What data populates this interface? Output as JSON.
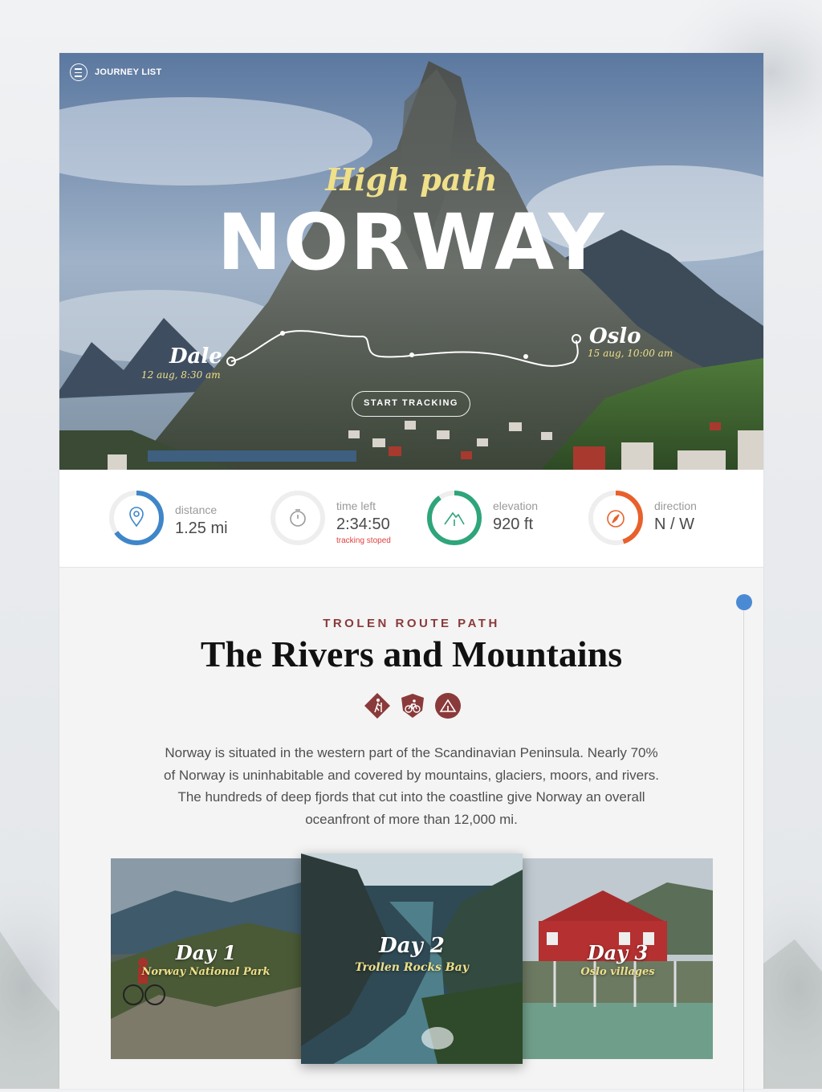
{
  "nav": {
    "menu_label": "JOURNEY LIST"
  },
  "hero": {
    "subtitle": "High path",
    "title": "NORWAY",
    "start": {
      "name": "Dale",
      "time": "12 aug, 8:30 am"
    },
    "end": {
      "name": "Oslo",
      "time": "15 aug, 10:00 am"
    },
    "cta_label": "START TRACKING"
  },
  "stats": [
    {
      "label": "distance",
      "value": "1.25 mi",
      "icon": "location-pin-icon",
      "color": "#3f86c9",
      "progress": 0.65
    },
    {
      "label": "time left",
      "value": "2:34:50",
      "note": "tracking stoped",
      "icon": "stopwatch-icon",
      "color": "#d9d9d9",
      "progress": 0
    },
    {
      "label": "elevation",
      "value": "920 ft",
      "icon": "mountain-icon",
      "color": "#2ea57a",
      "progress": 0.9
    },
    {
      "label": "direction",
      "value": "N / W",
      "icon": "compass-icon",
      "color": "#e8612c",
      "progress": 0.45
    }
  ],
  "section": {
    "kicker": "TROLEN ROUTE PATH",
    "title": "The Rivers and Mountains",
    "activities": [
      "hiking-icon",
      "cycling-icon",
      "camping-icon"
    ],
    "accent_color": "#8a3a3a",
    "description": "Norway is situated in the western part of the Scandinavian Peninsula. Nearly 70% of Norway is uninhabitable and covered by mountains, glaciers, moors, and rivers. The hundreds of deep fjords that cut into the coastline give Norway an overall oceanfront of more than 12,000 mi."
  },
  "days": [
    {
      "title": "Day 1",
      "subtitle": "Norway National Park"
    },
    {
      "title": "Day 2",
      "subtitle": "Trollen Rocks Bay"
    },
    {
      "title": "Day 3",
      "subtitle": "Oslo villages"
    }
  ],
  "timeline": {
    "color": "#4a8ad4"
  }
}
